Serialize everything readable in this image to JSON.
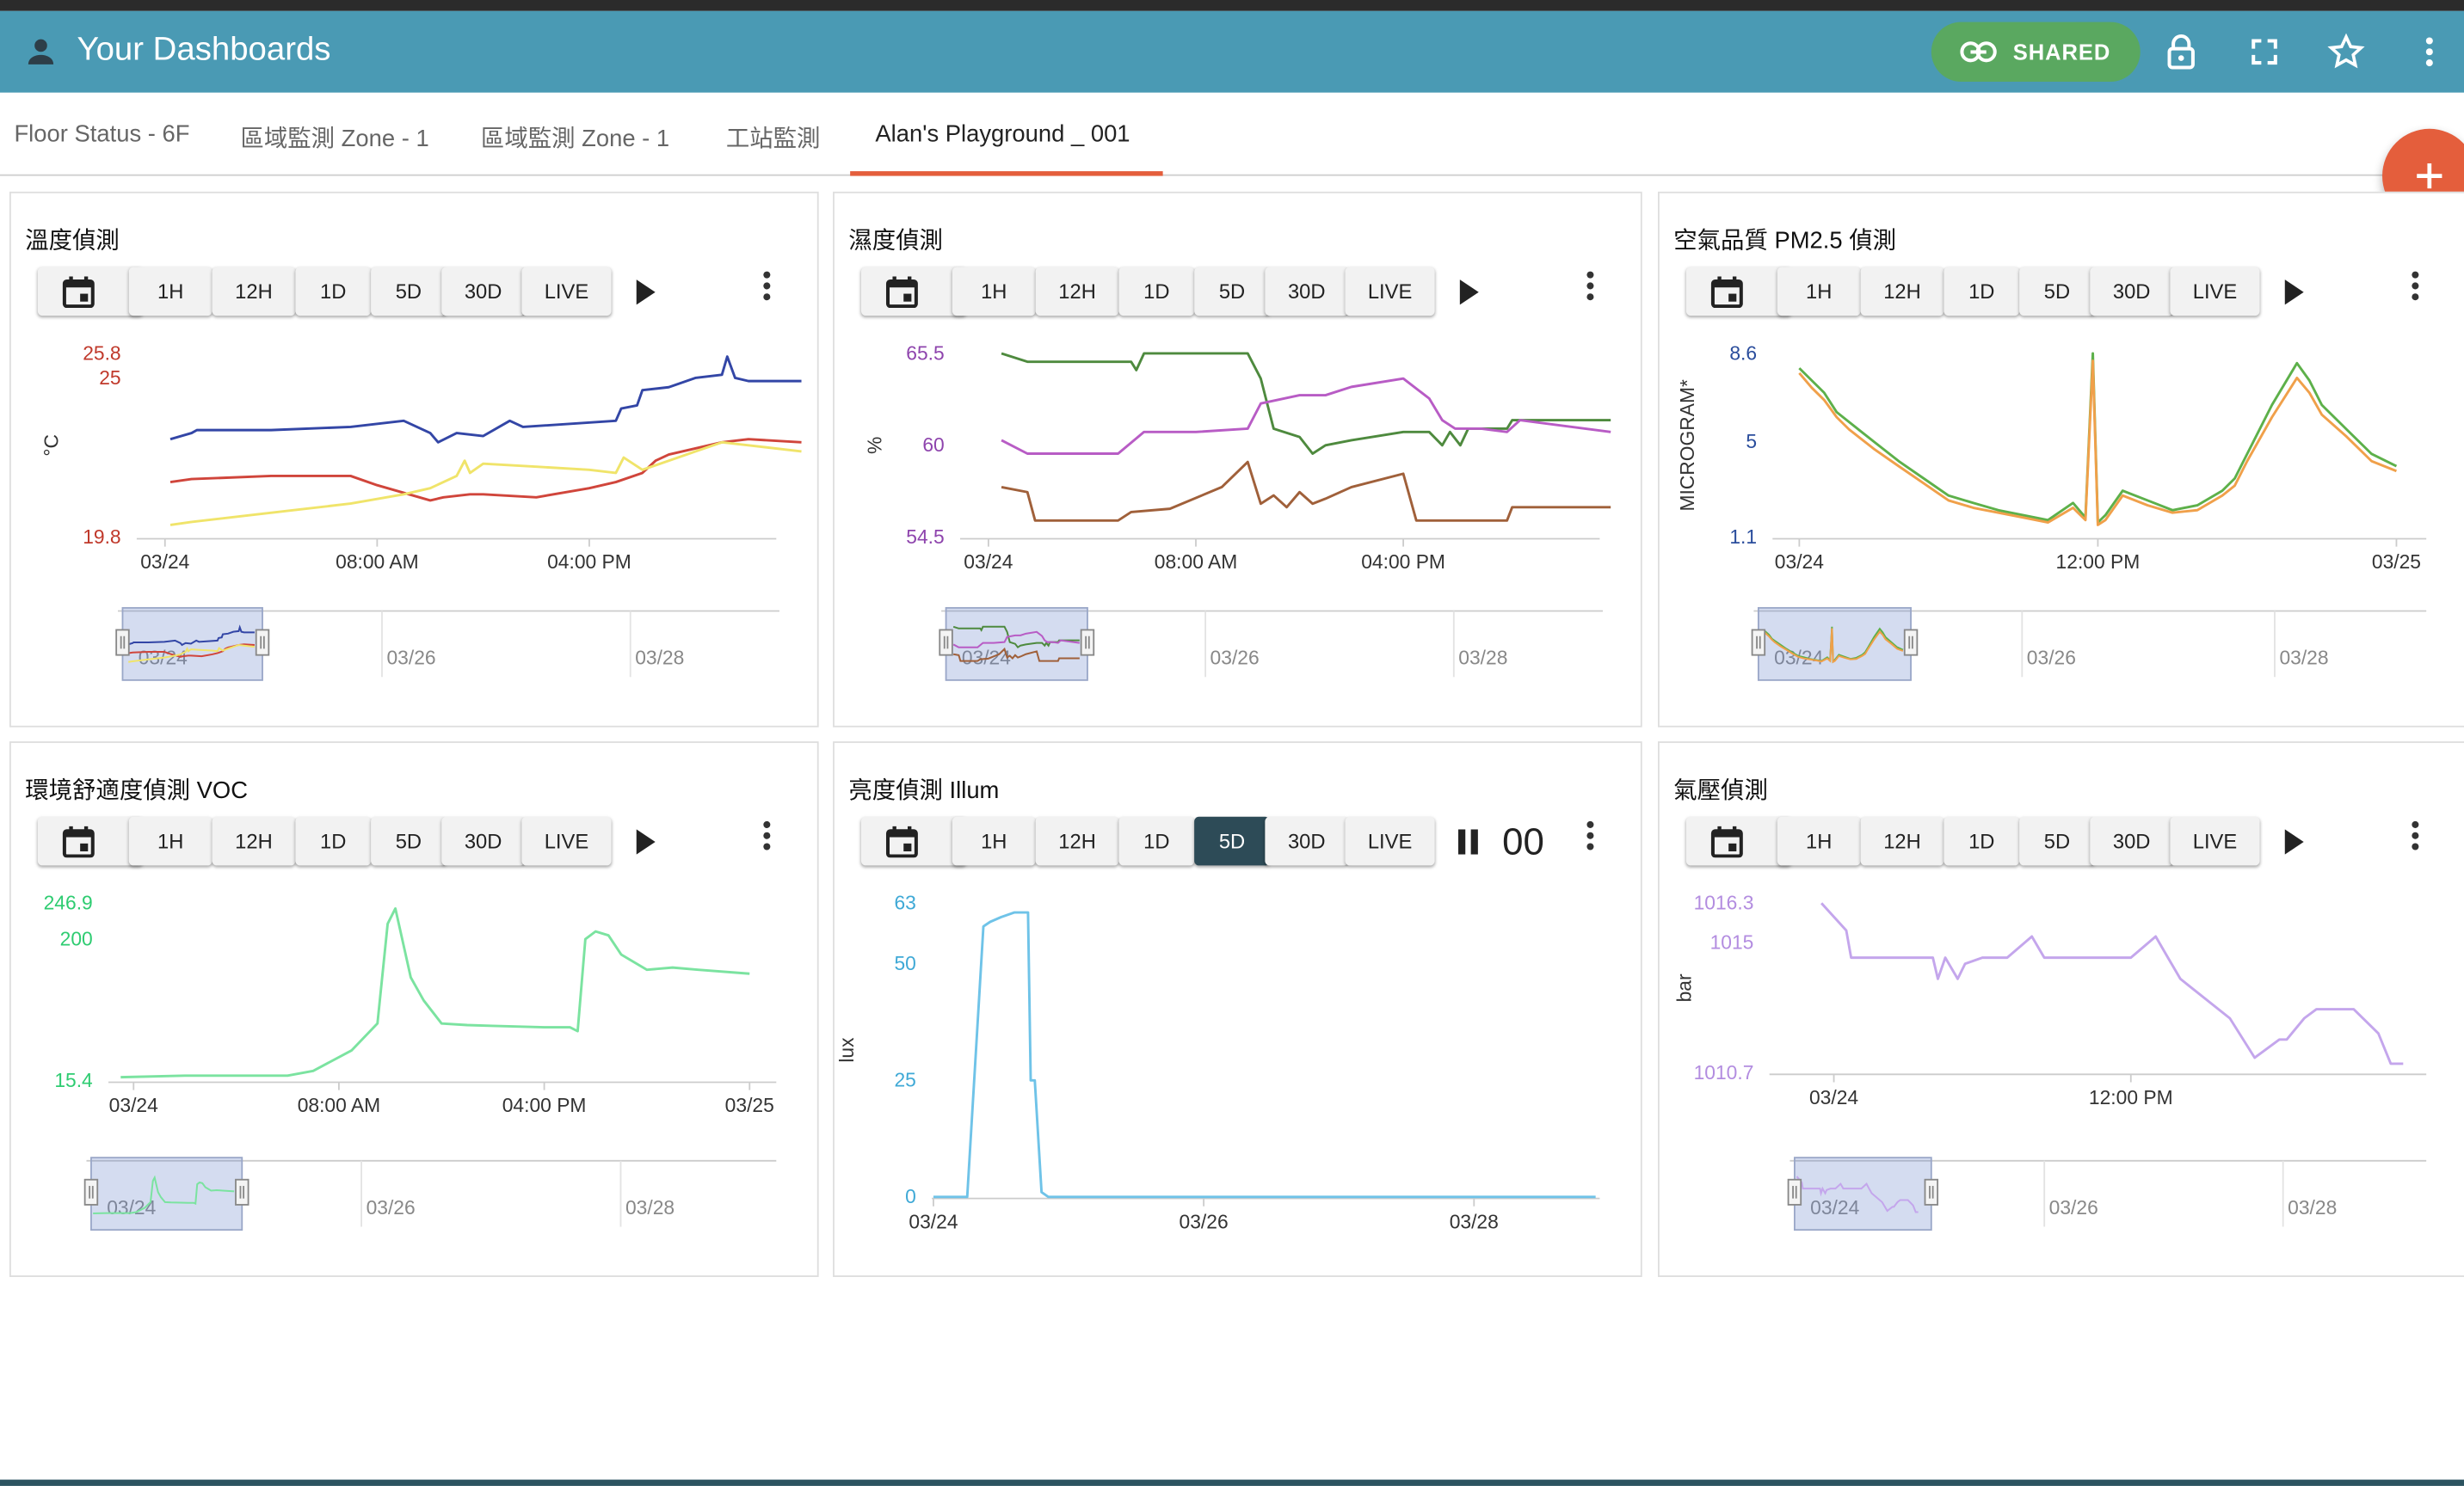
{
  "header": {
    "title": "Your Dashboards",
    "shared_label": "SHARED"
  },
  "tabs": [
    {
      "label": "Floor Status - 6F"
    },
    {
      "label": "區域監測 Zone - 1"
    },
    {
      "label": "區域監測 Zone - 1"
    },
    {
      "label": "工站監測"
    },
    {
      "label": "Alan's Playground _ 001"
    }
  ],
  "active_tab": 4,
  "time_buttons": [
    "1H",
    "12H",
    "1D",
    "5D",
    "30D",
    "LIVE"
  ],
  "panels": [
    {
      "title": "溫度偵測",
      "selected_range": "",
      "counter": ""
    },
    {
      "title": "濕度偵測",
      "selected_range": "",
      "counter": ""
    },
    {
      "title": "空氣品質 PM2.5 偵測",
      "selected_range": "",
      "counter": ""
    },
    {
      "title": "環境舒適度偵測 VOC",
      "selected_range": "",
      "counter": ""
    },
    {
      "title": "亮度偵測 Illum",
      "selected_range": "5D",
      "counter": "00",
      "paused": true
    },
    {
      "title": "氣壓偵測",
      "selected_range": "",
      "counter": ""
    }
  ],
  "chart_data": [
    {
      "type": "line",
      "title": "溫度偵測",
      "ylabel": "°C",
      "ylim": [
        19.8,
        25.8
      ],
      "yticks": [
        {
          "v": 25.8,
          "label": "25.8",
          "color": "#c0392b"
        },
        {
          "v": 25,
          "label": "25",
          "color": "#c0392b"
        },
        {
          "v": 19.8,
          "label": "19.8",
          "color": "#c0392b"
        }
      ],
      "xlim": [
        0,
        24
      ],
      "xticks": [
        {
          "v": 0,
          "label": "03/24"
        },
        {
          "v": 8,
          "label": "08:00 AM"
        },
        {
          "v": 16,
          "label": "04:00 PM"
        }
      ],
      "series": [
        {
          "color": "#3346a6",
          "x": [
            0.2,
            1,
            1.2,
            4,
            7,
            9,
            10,
            10.3,
            11,
            12,
            13,
            13.5,
            17,
            17.2,
            17.8,
            18,
            19,
            20,
            21,
            21.2,
            21.5,
            22,
            24
          ],
          "y": [
            23.0,
            23.2,
            23.3,
            23.3,
            23.4,
            23.6,
            23.2,
            22.9,
            23.2,
            23.1,
            23.6,
            23.4,
            23.6,
            24.0,
            24.1,
            24.6,
            24.7,
            25.0,
            25.1,
            25.7,
            25.0,
            24.9,
            24.9
          ]
        },
        {
          "color": "#d0453b",
          "x": [
            0.2,
            1,
            4,
            7,
            8,
            10,
            10.5,
            11.5,
            12,
            14,
            16,
            17,
            18,
            18.5,
            19,
            20,
            21,
            22,
            24
          ],
          "y": [
            21.6,
            21.7,
            21.8,
            21.8,
            21.5,
            21.0,
            21.1,
            21.2,
            21.2,
            21.1,
            21.4,
            21.6,
            21.9,
            22.3,
            22.5,
            22.7,
            22.9,
            23.0,
            22.9
          ]
        },
        {
          "color": "#f0e46a",
          "x": [
            0.2,
            1,
            3,
            5,
            7,
            9,
            10,
            11,
            11.3,
            11.5,
            12,
            14,
            16,
            17,
            17.3,
            18,
            19,
            20,
            21,
            22,
            24
          ],
          "y": [
            20.2,
            20.3,
            20.5,
            20.7,
            20.9,
            21.2,
            21.4,
            21.8,
            22.3,
            21.9,
            22.2,
            22.1,
            22.0,
            21.9,
            22.4,
            22.0,
            22.3,
            22.6,
            22.9,
            22.8,
            22.6
          ]
        }
      ]
    },
    {
      "type": "line",
      "title": "濕度偵測",
      "ylabel": "%",
      "ylim": [
        54.5,
        65.5
      ],
      "yticks": [
        {
          "v": 65.5,
          "label": "65.5",
          "color": "#8e44ad"
        },
        {
          "v": 60,
          "label": "60",
          "color": "#8e44ad"
        },
        {
          "v": 54.5,
          "label": "54.5",
          "color": "#8e44ad"
        }
      ],
      "xlim": [
        0,
        24
      ],
      "xticks": [
        {
          "v": 0,
          "label": "03/24"
        },
        {
          "v": 8,
          "label": "08:00 AM"
        },
        {
          "v": 16,
          "label": "04:00 PM"
        }
      ],
      "series": [
        {
          "color": "#4e8a3e",
          "x": [
            0.5,
            1.5,
            5.5,
            5.7,
            6,
            10,
            10.5,
            11,
            12,
            12.5,
            13,
            14,
            16,
            17,
            17.5,
            17.8,
            18.2,
            18.5,
            20,
            20.2,
            21,
            24
          ],
          "y": [
            65.5,
            65.0,
            65.0,
            64.5,
            65.5,
            65.5,
            64.0,
            61.0,
            60.5,
            59.5,
            60.0,
            60.3,
            60.8,
            60.8,
            60.0,
            60.8,
            60.0,
            61.0,
            61.0,
            61.5,
            61.5,
            61.5
          ]
        },
        {
          "color": "#b85cc5",
          "x": [
            0.5,
            1.5,
            5,
            6,
            8,
            10,
            10.5,
            12,
            13,
            14,
            16,
            17,
            17.5,
            18,
            19,
            20,
            20.5,
            24
          ],
          "y": [
            60.3,
            59.5,
            59.5,
            60.8,
            60.8,
            61.0,
            62.5,
            63.0,
            63.0,
            63.5,
            64.0,
            62.8,
            61.5,
            61.0,
            61.0,
            60.8,
            61.5,
            60.8
          ]
        },
        {
          "color": "#a0603a",
          "x": [
            0.5,
            1.5,
            1.8,
            5,
            5.5,
            7,
            9,
            10,
            10.5,
            11,
            11.5,
            12,
            12.5,
            13,
            14,
            16,
            16.5,
            20,
            20.2,
            24
          ],
          "y": [
            57.5,
            57.2,
            55.5,
            55.5,
            56.0,
            56.2,
            57.5,
            59.0,
            56.5,
            57.0,
            56.3,
            57.2,
            56.5,
            56.8,
            57.5,
            58.3,
            55.5,
            55.5,
            56.3,
            56.3
          ]
        }
      ]
    },
    {
      "type": "line",
      "title": "空氣品質 PM2.5 偵測",
      "ylabel": "MICROGRAM*",
      "ylim": [
        1.1,
        8.6
      ],
      "yticks": [
        {
          "v": 8.6,
          "label": "8.6",
          "color": "#2a4d9c"
        },
        {
          "v": 5,
          "label": "5",
          "color": "#2a4d9c"
        },
        {
          "v": 1.1,
          "label": "1.1",
          "color": "#2a4d9c"
        }
      ],
      "xlim": [
        0,
        24
      ],
      "xticks": [
        {
          "v": 0,
          "label": "03/24"
        },
        {
          "v": 12,
          "label": "12:00 PM"
        },
        {
          "v": 24,
          "label": "03/25"
        }
      ],
      "series": [
        {
          "color": "#5db04a",
          "x": [
            0,
            0.5,
            1,
            1.5,
            2,
            3,
            4,
            5,
            6,
            7,
            8,
            9,
            10,
            11,
            11.5,
            11.8,
            12,
            12.3,
            13,
            14,
            15,
            16,
            17,
            17.5,
            18,
            19,
            20,
            20.5,
            21,
            22,
            23,
            24
          ],
          "y": [
            8.0,
            7.5,
            7.0,
            6.2,
            5.8,
            5.0,
            4.2,
            3.5,
            2.8,
            2.5,
            2.2,
            2.0,
            1.8,
            2.5,
            1.9,
            8.6,
            1.7,
            2.0,
            3.0,
            2.6,
            2.2,
            2.4,
            3.0,
            3.5,
            4.5,
            6.5,
            8.2,
            7.5,
            6.5,
            5.5,
            4.5,
            4.0
          ]
        },
        {
          "color": "#f0a04a",
          "x": [
            0,
            0.5,
            1,
            1.5,
            2,
            3,
            4,
            5,
            6,
            7,
            8,
            9,
            10,
            11,
            11.5,
            11.8,
            12,
            12.3,
            13,
            14,
            15,
            16,
            17,
            17.5,
            18,
            19,
            20,
            20.5,
            21,
            22,
            23,
            24
          ],
          "y": [
            7.8,
            7.2,
            6.7,
            6.0,
            5.5,
            4.7,
            4.0,
            3.3,
            2.6,
            2.3,
            2.1,
            1.9,
            1.7,
            2.3,
            1.8,
            8.3,
            1.6,
            1.8,
            2.8,
            2.4,
            2.1,
            2.2,
            2.8,
            3.2,
            4.2,
            6.0,
            7.6,
            7.0,
            6.1,
            5.2,
            4.2,
            3.8
          ]
        }
      ]
    },
    {
      "type": "line",
      "title": "環境舒適度偵測 VOC",
      "ylabel": "",
      "ylim": [
        15.4,
        246.9
      ],
      "yticks": [
        {
          "v": 246.9,
          "label": "246.9",
          "color": "#2ecc71"
        },
        {
          "v": 200,
          "label": "200",
          "color": "#2ecc71"
        },
        {
          "v": 15.4,
          "label": "15.4",
          "color": "#2ecc71"
        }
      ],
      "xlim": [
        0,
        24
      ],
      "xticks": [
        {
          "v": 0,
          "label": "03/24"
        },
        {
          "v": 8,
          "label": "08:00 AM"
        },
        {
          "v": 16,
          "label": "04:00 PM"
        },
        {
          "v": 24,
          "label": "03/25"
        }
      ],
      "series": [
        {
          "color": "#7be3a0",
          "x": [
            -0.5,
            2,
            5,
            6,
            7,
            8.5,
            9.5,
            9.9,
            10.2,
            10.8,
            11.3,
            12,
            13,
            14,
            16,
            17,
            17.3,
            17.6,
            18,
            18.5,
            19,
            20,
            21,
            22,
            24
          ],
          "y": [
            20,
            22,
            22,
            22,
            28,
            55,
            90,
            220,
            240,
            150,
            120,
            90,
            88,
            87,
            85,
            85,
            80,
            200,
            210,
            205,
            180,
            160,
            163,
            160,
            155
          ]
        }
      ]
    },
    {
      "type": "line",
      "title": "亮度偵測 Illum",
      "ylabel": "lux",
      "ylim": [
        0,
        63
      ],
      "yticks": [
        {
          "v": 63,
          "label": "63",
          "color": "#3fa9d6"
        },
        {
          "v": 50,
          "label": "50",
          "color": "#3fa9d6"
        },
        {
          "v": 25,
          "label": "25",
          "color": "#3fa9d6"
        },
        {
          "v": 0,
          "label": "0",
          "color": "#3fa9d6"
        }
      ],
      "xlim": [
        0,
        5
      ],
      "xticks": [
        {
          "v": 0,
          "label": "03/24"
        },
        {
          "v": 2,
          "label": "03/26"
        },
        {
          "v": 4,
          "label": "03/28"
        }
      ],
      "series": [
        {
          "color": "#6fc3e8",
          "x": [
            0,
            0.25,
            0.37,
            0.42,
            0.5,
            0.6,
            0.7,
            0.72,
            0.75,
            0.8,
            0.85,
            0.9,
            4.9
          ],
          "y": [
            0,
            0,
            58,
            59,
            60,
            61,
            61,
            25,
            25,
            1,
            0,
            0,
            0
          ]
        }
      ]
    },
    {
      "type": "line",
      "title": "氣壓偵測",
      "ylabel": "bar",
      "ylim": [
        1010.7,
        1016.3
      ],
      "yticks": [
        {
          "v": 1016.3,
          "label": "1016.3",
          "color": "#b38de0"
        },
        {
          "v": 1015,
          "label": "1015",
          "color": "#b38de0"
        },
        {
          "v": 1010.7,
          "label": "1010.7",
          "color": "#b38de0"
        }
      ],
      "xlim": [
        0,
        24
      ],
      "xticks": [
        {
          "v": 0,
          "label": "03/24"
        },
        {
          "v": 12,
          "label": "12:00 PM"
        }
      ],
      "series": [
        {
          "color": "#c4a6ec",
          "x": [
            -0.5,
            0.5,
            0.7,
            3,
            4,
            4.2,
            4.5,
            5,
            5.3,
            6,
            7,
            8,
            8.5,
            9.5,
            10,
            12,
            13,
            13.5,
            14,
            16,
            17,
            18,
            18.3,
            19,
            19.5,
            21,
            22,
            22.5,
            23
          ],
          "y": [
            1016.3,
            1015.4,
            1014.5,
            1014.5,
            1014.5,
            1013.8,
            1014.5,
            1013.8,
            1014.3,
            1014.5,
            1014.5,
            1015.2,
            1014.5,
            1014.5,
            1014.5,
            1014.5,
            1015.2,
            1014.5,
            1013.8,
            1012.5,
            1011.2,
            1011.8,
            1011.8,
            1012.5,
            1012.8,
            1012.8,
            1012.0,
            1011.0,
            1011.0
          ]
        }
      ]
    }
  ],
  "navigator_ticks": [
    "03/24",
    "03/26",
    "03/28"
  ],
  "colors": {
    "appbar": "#4a9ab4",
    "shared": "#5aa860",
    "accent": "#e45e3c",
    "selected_range": "#2d4b57"
  }
}
